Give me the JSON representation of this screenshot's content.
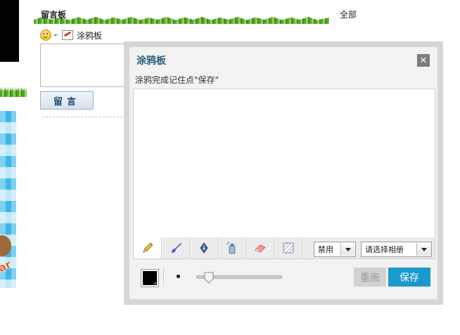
{
  "guestbook": {
    "title": "留言板",
    "all_link": "全部",
    "graffiti_label": "涂鸦板",
    "post_button": "留言"
  },
  "modal": {
    "title": "涂鸦板",
    "close_symbol": "✕",
    "hint": "涂鸦完成记住点\"保存\"",
    "tools": [
      {
        "name": "pencil",
        "icon": "pencil-icon"
      },
      {
        "name": "brush",
        "icon": "brush-icon"
      },
      {
        "name": "pen",
        "icon": "pen-nib-icon"
      },
      {
        "name": "spray",
        "icon": "spray-can-icon"
      },
      {
        "name": "eraser",
        "icon": "eraser-icon"
      },
      {
        "name": "texture",
        "icon": "hatch-fill-icon"
      }
    ],
    "mode_select": "禁用",
    "album_select": "请选择相册",
    "current_color": "#000000",
    "brush_size_fraction": 0.15,
    "reset_button": "重画",
    "save_button": "保存"
  },
  "decoration": {
    "banner_fragment": "ar"
  },
  "colors": {
    "accent": "#1a99cf",
    "title": "#2b5c7e"
  }
}
